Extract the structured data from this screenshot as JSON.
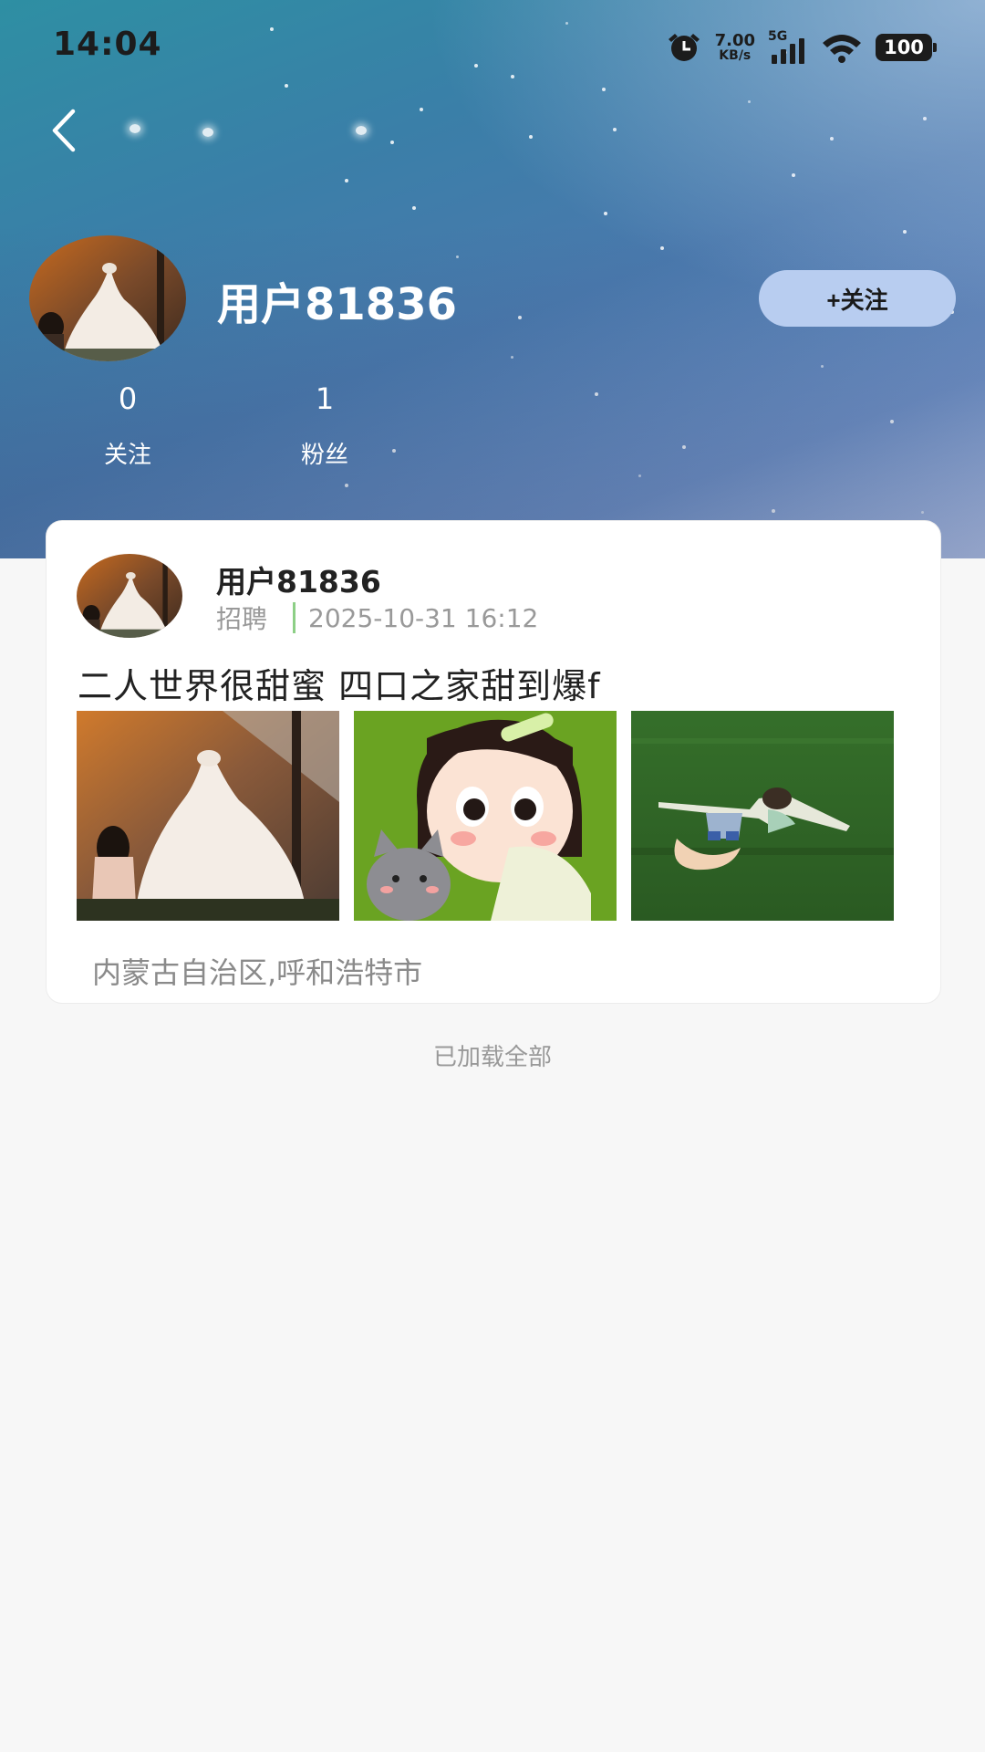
{
  "status_bar": {
    "time": "14:04",
    "speed_value": "7.00",
    "speed_unit": "KB/s",
    "network": "5G",
    "battery": "100"
  },
  "profile": {
    "username": "用户81836",
    "follow_label": "+关注",
    "stats": [
      {
        "value": "0",
        "label": "关注"
      },
      {
        "value": "1",
        "label": "粉丝"
      }
    ]
  },
  "post": {
    "author": "用户81836",
    "category": "招聘",
    "timestamp": "2025-10-31 16:12",
    "text": "二人世界很甜蜜 四口之家甜到爆f",
    "location": "内蒙古自治区,呼和浩特市",
    "images": [
      "wedding-dress-photo",
      "cartoon-girl-with-cat",
      "person-lying-on-grass"
    ]
  },
  "footer": {
    "loaded_all": "已加载全部"
  },
  "colors": {
    "follow_button": "#b8cdf0",
    "category_divider": "#8dcf86",
    "page_background": "#f7f7f7"
  }
}
